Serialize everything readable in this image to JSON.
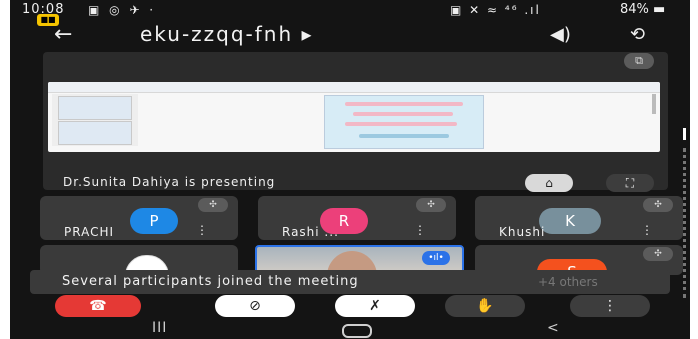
{
  "status_bar": {
    "time": "10:08",
    "left_icons": "▣ ◎ ✈ ·",
    "right_icons": "▣ ✕ ≈ ⁴⁶ .ıl",
    "battery": "84% ▬"
  },
  "top_bar": {
    "back_icon": "←",
    "meeting_code": "eku-zzqq-fnh ▸",
    "speaker_icon": "◀)",
    "flip_icon": "⟲",
    "badge": "■■"
  },
  "presentation": {
    "presenter_caption": "Dr.Sunita Dahiya is presenting",
    "pip_icon": "⧉",
    "stop_icon": "⌂",
    "fullscreen_icon": "⛶"
  },
  "participants": [
    {
      "initial": "P",
      "name": "PRACHI",
      "avatar_color": "#1e88e5"
    },
    {
      "initial": "R",
      "name": "Rashi ...",
      "avatar_color": "#ec407a"
    },
    {
      "initial": "K",
      "name": "Khushi",
      "avatar_color": "#78909c"
    },
    {
      "initial": "",
      "name": "",
      "avatar_color": "#ffffff"
    },
    {
      "initial": "S",
      "name": "",
      "avatar_color": "#f4511e"
    }
  ],
  "tile_icons": {
    "mic": "✣",
    "more": "⋮",
    "speaking": "•ıl•"
  },
  "toast": {
    "message": "Several participants joined the meeting",
    "faded_text": "+4 others"
  },
  "controls": {
    "end_call": "☎",
    "camera": "⊘",
    "mic": "✗",
    "raise_hand": "✋",
    "more": "⋮"
  },
  "nav": {
    "recent": "III",
    "home": "",
    "back": "<"
  }
}
